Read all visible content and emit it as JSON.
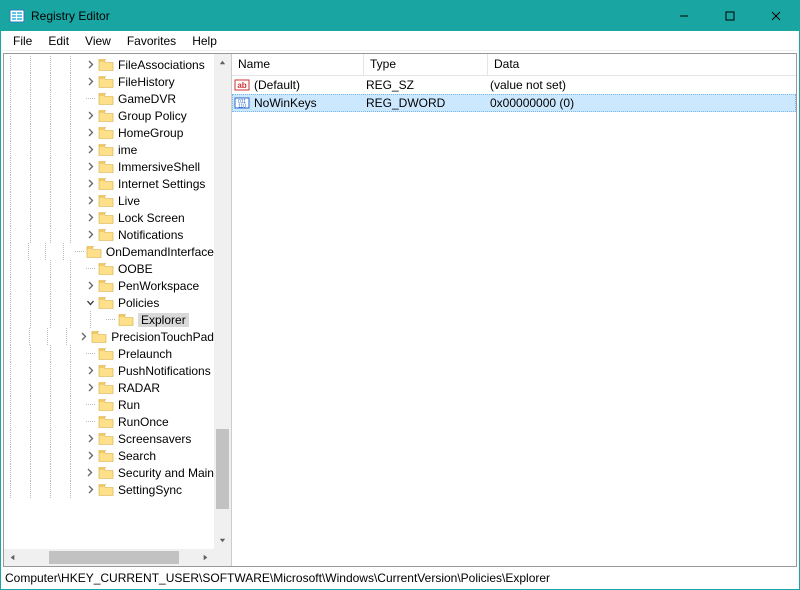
{
  "window": {
    "title": "Registry Editor"
  },
  "menubar": [
    "File",
    "Edit",
    "View",
    "Favorites",
    "Help"
  ],
  "tree": {
    "items": [
      {
        "label": "FileAssociations",
        "expander": "collapsed",
        "indent": 4
      },
      {
        "label": "FileHistory",
        "expander": "collapsed",
        "indent": 4
      },
      {
        "label": "GameDVR",
        "expander": "none",
        "indent": 4
      },
      {
        "label": "Group Policy",
        "expander": "collapsed",
        "indent": 4
      },
      {
        "label": "HomeGroup",
        "expander": "collapsed",
        "indent": 4
      },
      {
        "label": "ime",
        "expander": "collapsed",
        "indent": 4
      },
      {
        "label": "ImmersiveShell",
        "expander": "collapsed",
        "indent": 4
      },
      {
        "label": "Internet Settings",
        "expander": "collapsed",
        "indent": 4
      },
      {
        "label": "Live",
        "expander": "collapsed",
        "indent": 4
      },
      {
        "label": "Lock Screen",
        "expander": "collapsed",
        "indent": 4
      },
      {
        "label": "Notifications",
        "expander": "collapsed",
        "indent": 4
      },
      {
        "label": "OnDemandInterface",
        "expander": "none",
        "indent": 4,
        "clipped": true
      },
      {
        "label": "OOBE",
        "expander": "none",
        "indent": 4
      },
      {
        "label": "PenWorkspace",
        "expander": "collapsed",
        "indent": 4
      },
      {
        "label": "Policies",
        "expander": "expanded",
        "indent": 4
      },
      {
        "label": "Explorer",
        "expander": "none",
        "indent": 5,
        "selected": true
      },
      {
        "label": "PrecisionTouchPad",
        "expander": "collapsed",
        "indent": 4,
        "clipped": true
      },
      {
        "label": "Prelaunch",
        "expander": "none",
        "indent": 4
      },
      {
        "label": "PushNotifications",
        "expander": "collapsed",
        "indent": 4
      },
      {
        "label": "RADAR",
        "expander": "collapsed",
        "indent": 4
      },
      {
        "label": "Run",
        "expander": "none",
        "indent": 4
      },
      {
        "label": "RunOnce",
        "expander": "none",
        "indent": 4
      },
      {
        "label": "Screensavers",
        "expander": "collapsed",
        "indent": 4
      },
      {
        "label": "Search",
        "expander": "collapsed",
        "indent": 4
      },
      {
        "label": "Security and Maintenance",
        "expander": "collapsed",
        "indent": 4,
        "clipped": true
      },
      {
        "label": "SettingSync",
        "expander": "collapsed",
        "indent": 4
      }
    ]
  },
  "list": {
    "columns": {
      "name": "Name",
      "type": "Type",
      "data": "Data"
    },
    "rows": [
      {
        "icon": "string",
        "name": "(Default)",
        "type": "REG_SZ",
        "data": "(value not set)",
        "selected": false
      },
      {
        "icon": "dword",
        "name": "NoWinKeys",
        "type": "REG_DWORD",
        "data": "0x00000000 (0)",
        "selected": true
      }
    ]
  },
  "statusbar": "Computer\\HKEY_CURRENT_USER\\SOFTWARE\\Microsoft\\Windows\\CurrentVersion\\Policies\\Explorer"
}
